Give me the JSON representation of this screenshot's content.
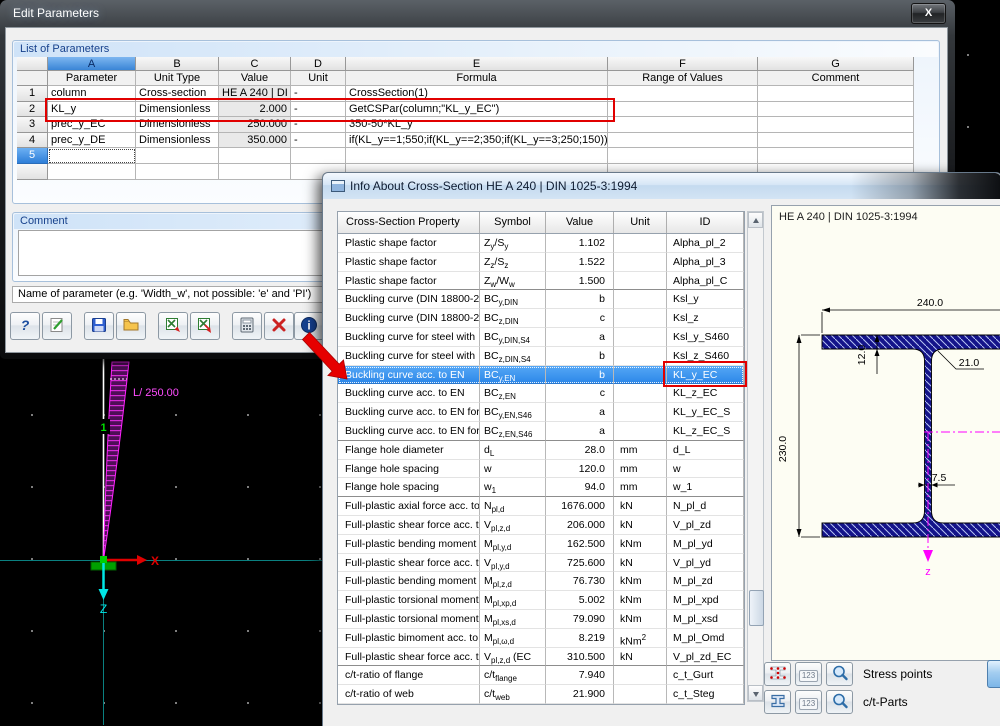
{
  "dialog": {
    "title": "Edit Parameters",
    "close": "X",
    "list_group": {
      "title": "List of Parameters",
      "col_letters": [
        "A",
        "B",
        "C",
        "D",
        "E",
        "F",
        "G"
      ],
      "headers": [
        "Parameter",
        "Unit Type",
        "Value",
        "Unit",
        "Formula",
        "Range of Values",
        "Comment"
      ],
      "rows": [
        {
          "num": "1",
          "cells": [
            "column",
            "Cross-section",
            "HE A 240 | DI",
            "-",
            "CrossSection(1)",
            "",
            ""
          ]
        },
        {
          "num": "2",
          "cells": [
            "KL_y",
            "Dimensionless",
            "2.000",
            "-",
            "GetCSPar(column;\"KL_y_EC\")",
            "",
            ""
          ],
          "red_box": true
        },
        {
          "num": "3",
          "cells": [
            "prec_y_EC",
            "Dimensionless",
            "250.000",
            "-",
            "350-50*KL_y",
            "",
            ""
          ]
        },
        {
          "num": "4",
          "cells": [
            "prec_y_DE",
            "Dimensionless",
            "350.000",
            "-",
            "if(KL_y==1;550;if(KL_y==2;350;if(KL_y==3;250;150)))",
            "",
            ""
          ]
        },
        {
          "num": "5",
          "cells": [
            "",
            "",
            "",
            "",
            "",
            "",
            ""
          ],
          "selected": true
        },
        {
          "num": "",
          "cells": [
            "",
            "",
            "",
            "",
            "",
            "",
            ""
          ]
        }
      ]
    },
    "comment_group": {
      "title": "Comment",
      "value": ""
    },
    "hint": "Name of parameter (e.g. 'Width_w', not possible: 'e' and 'PI')",
    "toolbar_icons": [
      "help-icon",
      "edit-icon",
      "save-icon",
      "open-folder-icon",
      "import-table-icon",
      "export-table-icon",
      "calculator-icon",
      "delete-icon",
      "info-icon"
    ]
  },
  "info_window": {
    "title": "Info About Cross-Section HE A 240 | DIN 1025-3:1994",
    "columns": [
      "Cross-Section Property",
      "Symbol",
      "Value",
      "Unit",
      "ID"
    ],
    "rows": [
      {
        "p": "Plastic shape factor",
        "s": "Z~y~/S~y~",
        "v": "1.102",
        "u": "",
        "id": "Alpha_pl_2"
      },
      {
        "p": "Plastic shape factor",
        "s": "Z~z~/S~z~",
        "v": "1.522",
        "u": "",
        "id": "Alpha_pl_3"
      },
      {
        "p": "Plastic shape factor",
        "s": "Z~w~/W~w~",
        "v": "1.500",
        "u": "",
        "id": "Alpha_pl_C",
        "group_end": true
      },
      {
        "p": "Buckling curve (DIN 18800-2:",
        "s": "BC~y,DIN~",
        "v": "b",
        "u": "",
        "id": "Ksl_y"
      },
      {
        "p": "Buckling curve (DIN 18800-2:",
        "s": "BC~z,DIN~",
        "v": "c",
        "u": "",
        "id": "Ksl_z"
      },
      {
        "p": "Buckling curve for steel with",
        "s": "BC~y,DIN,S4~",
        "v": "a",
        "u": "",
        "id": "Ksl_y_S460"
      },
      {
        "p": "Buckling curve for steel with",
        "s": "BC~z,DIN,S4~",
        "v": "b",
        "u": "",
        "id": "Ksl_z_S460"
      },
      {
        "p": "Buckling curve acc. to EN",
        "s": "BC~y,EN~",
        "v": "b",
        "u": "",
        "id": "KL_y_EC",
        "sel": true
      },
      {
        "p": "Buckling curve acc. to EN",
        "s": "BC~z,EN~",
        "v": "c",
        "u": "",
        "id": "KL_z_EC"
      },
      {
        "p": "Buckling curve acc. to EN for",
        "s": "BC~y,EN,S46~",
        "v": "a",
        "u": "",
        "id": "KL_y_EC_S"
      },
      {
        "p": "Buckling curve acc. to EN for",
        "s": "BC~z,EN,S46~",
        "v": "a",
        "u": "",
        "id": "KL_z_EC_S",
        "group_end": true
      },
      {
        "p": "Flange hole diameter",
        "s": "d~L~",
        "v": "28.0",
        "u": "mm",
        "id": "d_L"
      },
      {
        "p": "Flange hole spacing",
        "s": "w",
        "v": "120.0",
        "u": "mm",
        "id": "w"
      },
      {
        "p": "Flange hole spacing",
        "s": "w~1~",
        "v": "94.0",
        "u": "mm",
        "id": "w_1",
        "group_end": true
      },
      {
        "p": "Full-plastic axial force acc. to",
        "s": "N~pl,d~",
        "v": "1676.000",
        "u": "kN",
        "id": "N_pl_d"
      },
      {
        "p": "Full-plastic shear force acc. t",
        "s": "V~pl,z,d~",
        "v": "206.000",
        "u": "kN",
        "id": "V_pl_zd"
      },
      {
        "p": "Full-plastic bending moment a",
        "s": "M~pl,y,d~",
        "v": "162.500",
        "u": "kNm",
        "id": "M_pl_yd"
      },
      {
        "p": "Full-plastic shear force acc. t",
        "s": "V~pl,y,d~",
        "v": "725.600",
        "u": "kN",
        "id": "V_pl_yd"
      },
      {
        "p": "Full-plastic bending moment a",
        "s": "M~pl,z,d~",
        "v": "76.730",
        "u": "kNm",
        "id": "M_pl_zd"
      },
      {
        "p": "Full-plastic torsional moment",
        "s": "M~pl,xp,d~",
        "v": "5.002",
        "u": "kNm",
        "id": "M_pl_xpd"
      },
      {
        "p": "Full-plastic torsional moment",
        "s": "M~pl,xs,d~",
        "v": "79.090",
        "u": "kNm",
        "id": "M_pl_xsd"
      },
      {
        "p": "Full-plastic bimoment acc. to",
        "s": "M~pl,ω,d~",
        "v": "8.219",
        "u": "kNm^2^",
        "id": "M_pl_Omd"
      },
      {
        "p": "Full-plastic shear force acc. t",
        "s": "V~pl,z,d~ (EC",
        "v": "310.500",
        "u": "kN",
        "id": "V_pl_zd_EC",
        "group_end": true
      },
      {
        "p": "c/t-ratio of flange",
        "s": "c/t~flange~",
        "v": "7.940",
        "u": "",
        "id": "c_t_Gurt"
      },
      {
        "p": "c/t-ratio of web",
        "s": "c/t~web~",
        "v": "21.900",
        "u": "",
        "id": "c_t_Steg"
      }
    ],
    "panel": {
      "title": "HE A 240 | DIN 1025-3:1994",
      "dim_width": "240.0",
      "dim_flange": "12.0",
      "dim_radius": "21.0",
      "dim_height": "230.0",
      "dim_web": "7.5",
      "axis_z": "z"
    },
    "controls": {
      "stress_points": "Stress points",
      "ct_parts": "c/t-Parts",
      "num_label": "123"
    }
  },
  "viewport": {
    "member_number": "1",
    "deflection_label": "L/ 250.00",
    "axis_x": "X",
    "axis_z": "Z"
  },
  "colors": {
    "selection_blue": "#3399ff",
    "annotation_red": "#e10000",
    "magenta": "#ff00ff",
    "section_navy": "#14148a",
    "axis_cyan": "#00e6e6",
    "support_green": "#00a000"
  }
}
